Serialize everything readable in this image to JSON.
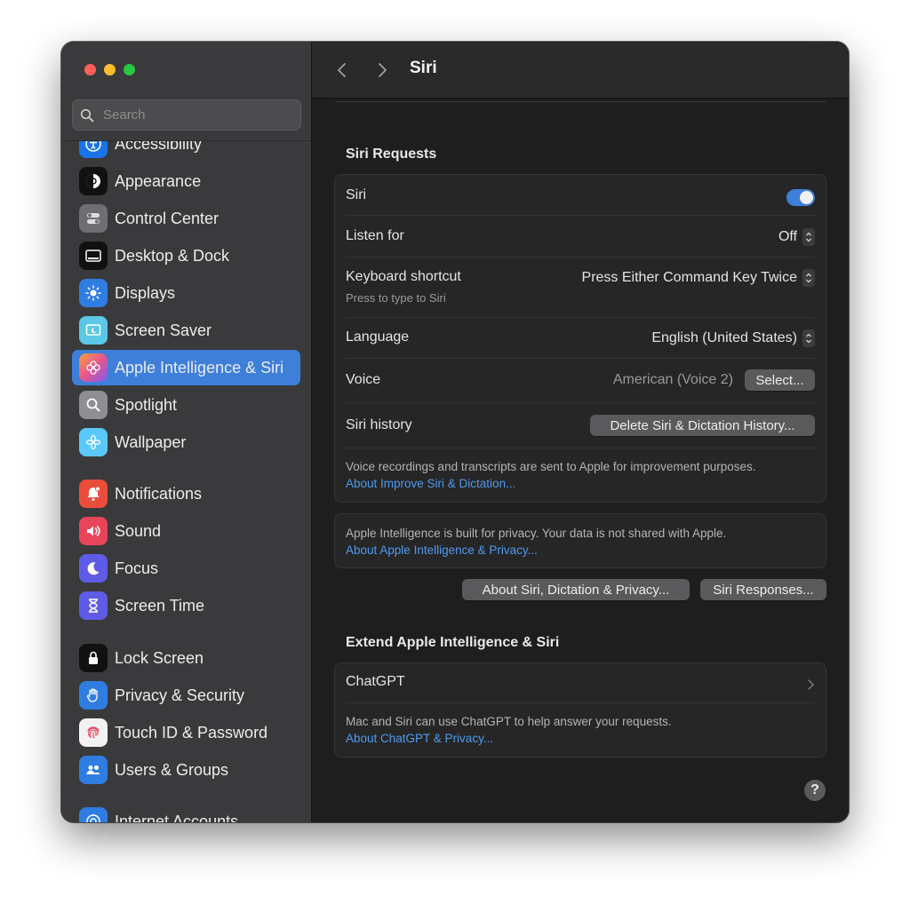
{
  "window": {
    "title": "Siri"
  },
  "search": {
    "placeholder": "Search"
  },
  "sidebar": {
    "items": [
      {
        "label": "Accessibility",
        "icon": "accessibility-icon",
        "color": "#1a73e8"
      },
      {
        "label": "Appearance",
        "icon": "appearance-icon",
        "color": "#111111"
      },
      {
        "label": "Control Center",
        "icon": "control-center-icon",
        "color": "#6e6e73"
      },
      {
        "label": "Desktop & Dock",
        "icon": "desktop-dock-icon",
        "color": "#111111"
      },
      {
        "label": "Displays",
        "icon": "displays-icon",
        "color": "#2f7de1"
      },
      {
        "label": "Screen Saver",
        "icon": "screen-saver-icon",
        "color": "#5ac8e6"
      },
      {
        "label": "Apple Intelligence & Siri",
        "icon": "apple-intelligence-icon",
        "color": "#e86a9a"
      },
      {
        "label": "Spotlight",
        "icon": "spotlight-icon",
        "color": "#8e8e93"
      },
      {
        "label": "Wallpaper",
        "icon": "wallpaper-icon",
        "color": "#5ac8fa"
      },
      {
        "label": "Notifications",
        "icon": "notifications-icon",
        "color": "#eb4d3d"
      },
      {
        "label": "Sound",
        "icon": "sound-icon",
        "color": "#e8455a"
      },
      {
        "label": "Focus",
        "icon": "focus-icon",
        "color": "#5e5ce6"
      },
      {
        "label": "Screen Time",
        "icon": "screen-time-icon",
        "color": "#5e5ce6"
      },
      {
        "label": "Lock Screen",
        "icon": "lock-screen-icon",
        "color": "#111111"
      },
      {
        "label": "Privacy & Security",
        "icon": "privacy-hand-icon",
        "color": "#2f7de1"
      },
      {
        "label": "Touch ID & Password",
        "icon": "fingerprint-icon",
        "color": "#f2f2f2"
      },
      {
        "label": "Users & Groups",
        "icon": "users-groups-icon",
        "color": "#2f7de1"
      },
      {
        "label": "Internet Accounts",
        "icon": "internet-accounts-icon",
        "color": "#2f7de1"
      }
    ]
  },
  "siri_requests": {
    "title": "Siri Requests",
    "siri": {
      "label": "Siri",
      "enabled": true
    },
    "listen_for": {
      "label": "Listen for",
      "value": "Off"
    },
    "keyboard_shortcut": {
      "label": "Keyboard shortcut",
      "sublabel": "Press to type to Siri",
      "value": "Press Either Command Key Twice"
    },
    "language": {
      "label": "Language",
      "value": "English (United States)"
    },
    "voice": {
      "label": "Voice",
      "value": "American (Voice 2)",
      "button": "Select..."
    },
    "history": {
      "label": "Siri history",
      "button": "Delete Siri & Dictation History..."
    },
    "note": "Voice recordings and transcripts are sent to Apple for improvement purposes.",
    "note_link": "About Improve Siri & Dictation..."
  },
  "privacy": {
    "note": "Apple Intelligence is built for privacy. Your data is not shared with Apple.",
    "link": "About Apple Intelligence & Privacy..."
  },
  "buttons": {
    "about_privacy": "About Siri, Dictation & Privacy...",
    "responses": "Siri Responses..."
  },
  "extend": {
    "title": "Extend Apple Intelligence & Siri",
    "chatgpt": {
      "label": "ChatGPT"
    },
    "note": "Mac and Siri can use ChatGPT to help answer your requests.",
    "link": "About ChatGPT & Privacy..."
  },
  "help": {
    "label": "?"
  },
  "colors": {
    "accent": "#3d7fd9",
    "link": "#4e9af1"
  }
}
